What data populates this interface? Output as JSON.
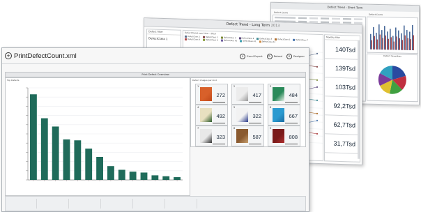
{
  "back_window": {
    "title": "Defect Trend - Short Term",
    "section_left": "Defect Count",
    "section_right": "Defect Count",
    "pie_title": "Defect Severities",
    "bars": [
      0.55,
      0.8,
      0.6,
      0.9,
      0.7,
      0.85,
      0.65,
      0.75,
      0.5,
      0.8,
      0.7,
      0.6,
      0.88,
      0.72,
      0.66,
      0.9
    ]
  },
  "middle_window": {
    "title": "Defect Trend - Long Term",
    "year": "2013",
    "filter_header": "Defect filter",
    "filter_item": "DefectClass 1",
    "chart_header": "Defect trend over time - 2013",
    "legend": [
      {
        "label": "DefectClass 1",
        "color": "#5b6e8c"
      },
      {
        "label": "DefectClass 2",
        "color": "#8a4b4b"
      },
      {
        "label": "DefectClass 3",
        "color": "#7d8c3a"
      },
      {
        "label": "DefectClass 4",
        "color": "#5e4a80"
      },
      {
        "label": "DefectClass 5",
        "color": "#3e8a94"
      },
      {
        "label": "DefectClass 6",
        "color": "#b07030"
      },
      {
        "label": "DefectClass 7",
        "color": "#4c78b0"
      },
      {
        "label": "DefectClass 8",
        "color": "#b04848"
      },
      {
        "label": "DefectClass 9",
        "color": "#8aa040"
      },
      {
        "label": "DefectClass 10",
        "color": "#7060a0"
      },
      {
        "label": "DefectClass 11",
        "color": "#40a0b0"
      },
      {
        "label": "DefectClass 12",
        "color": "#d08a40"
      }
    ],
    "kpi_header": "Monthly filter",
    "kpis": [
      "140Tsd",
      "139Tsd",
      "103Tsd",
      "92,2Tsd",
      "62,7Tsd",
      "31,7Tsd"
    ]
  },
  "front_window": {
    "title": "PrintDefectCount.xml",
    "buttons": {
      "excel_export": "Excel Export",
      "reload": "Reload",
      "designer": "Designer"
    },
    "overview_title": "Print Defect Overview",
    "chart_header": "Top Defects",
    "image_grid_header": "Defect images per kind",
    "tiles": [
      {
        "num": "1",
        "value": "272",
        "colors": [
          "#d8602a",
          "#c04818"
        ]
      },
      {
        "num": "2",
        "value": "417",
        "colors": [
          "#ececec",
          "#999999"
        ]
      },
      {
        "num": "3",
        "value": "484",
        "colors": [
          "#2a8a5a",
          "#e8f0e8"
        ]
      },
      {
        "num": "4",
        "value": "492",
        "colors": [
          "#e8e0c0",
          "#2b5a2a"
        ]
      },
      {
        "num": "5",
        "value": "322",
        "colors": [
          "#f2f2f2",
          "#2a3a8a"
        ]
      },
      {
        "num": "6",
        "value": "667",
        "colors": [
          "#2a9ad0",
          "#1a6aa0"
        ]
      },
      {
        "num": "7",
        "value": "323",
        "colors": [
          "#e8e8e8",
          "#333333"
        ]
      },
      {
        "num": "8",
        "value": "587",
        "colors": [
          "#8a5a30",
          "#c8a070"
        ]
      },
      {
        "num": "9",
        "value": "808",
        "colors": [
          "#7a1a1a",
          "#b03030"
        ]
      }
    ]
  },
  "chart_data": {
    "type": "bar",
    "title": "",
    "xlabel": "",
    "ylabel": "",
    "ylim": [
      0,
      1
    ],
    "categories": [
      "1",
      "2",
      "3",
      "4",
      "5",
      "6",
      "7",
      "8",
      "9",
      "10",
      "11",
      "12",
      "13",
      "14"
    ],
    "values": [
      0.93,
      0.67,
      0.58,
      0.44,
      0.43,
      0.34,
      0.25,
      0.15,
      0.11,
      0.09,
      0.08,
      0.05,
      0.04,
      0.03
    ],
    "bar_color": "#1f6b5a"
  }
}
